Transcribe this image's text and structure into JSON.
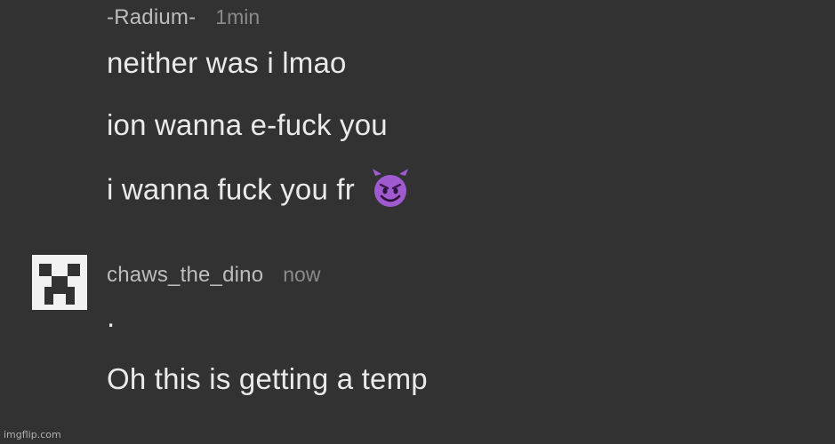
{
  "messages": [
    {
      "username": "-Radium-",
      "time": "1min",
      "lines": [
        "neither was i lmao",
        "ion wanna e-fuck you",
        "i wanna fuck you fr"
      ],
      "emoji": "smiling-devil-icon"
    },
    {
      "username": "chaws_the_dino",
      "time": "now",
      "avatar": "pixel-creeper-icon",
      "lines": [
        ".",
        "Oh this is getting a temp"
      ]
    }
  ],
  "watermark": "imgflip.com",
  "colors": {
    "background": "#323232",
    "username": "#bdbdbd",
    "timestamp": "#8a8a8a",
    "text": "#eaeaea",
    "emoji": "#a05ad0"
  }
}
